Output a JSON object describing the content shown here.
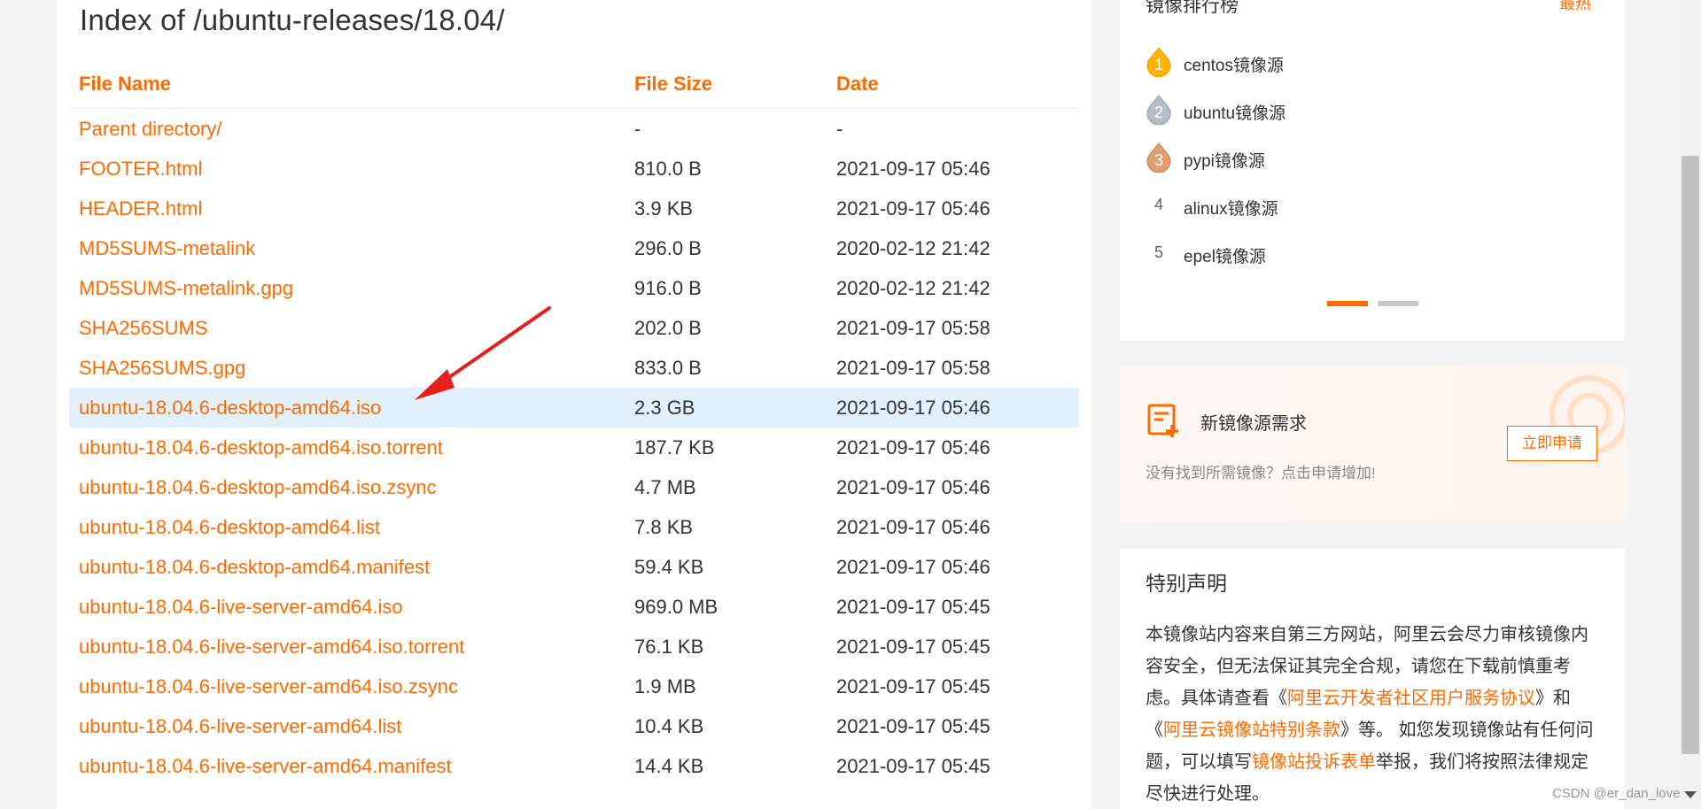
{
  "page_title": "Index of /ubuntu-releases/18.04/",
  "table": {
    "headers": [
      "File Name",
      "File Size",
      "Date"
    ],
    "rows": [
      {
        "name": "Parent directory/",
        "size": "-",
        "date": "-"
      },
      {
        "name": "FOOTER.html",
        "size": "810.0 B",
        "date": "2021-09-17 05:46"
      },
      {
        "name": "HEADER.html",
        "size": "3.9 KB",
        "date": "2021-09-17 05:46"
      },
      {
        "name": "MD5SUMS-metalink",
        "size": "296.0 B",
        "date": "2020-02-12 21:42"
      },
      {
        "name": "MD5SUMS-metalink.gpg",
        "size": "916.0 B",
        "date": "2020-02-12 21:42"
      },
      {
        "name": "SHA256SUMS",
        "size": "202.0 B",
        "date": "2021-09-17 05:58"
      },
      {
        "name": "SHA256SUMS.gpg",
        "size": "833.0 B",
        "date": "2021-09-17 05:58"
      },
      {
        "name": "ubuntu-18.04.6-desktop-amd64.iso",
        "size": "2.3 GB",
        "date": "2021-09-17 05:46"
      },
      {
        "name": "ubuntu-18.04.6-desktop-amd64.iso.torrent",
        "size": "187.7 KB",
        "date": "2021-09-17 05:46"
      },
      {
        "name": "ubuntu-18.04.6-desktop-amd64.iso.zsync",
        "size": "4.7 MB",
        "date": "2021-09-17 05:46"
      },
      {
        "name": "ubuntu-18.04.6-desktop-amd64.list",
        "size": "7.8 KB",
        "date": "2021-09-17 05:46"
      },
      {
        "name": "ubuntu-18.04.6-desktop-amd64.manifest",
        "size": "59.4 KB",
        "date": "2021-09-17 05:46"
      },
      {
        "name": "ubuntu-18.04.6-live-server-amd64.iso",
        "size": "969.0 MB",
        "date": "2021-09-17 05:45"
      },
      {
        "name": "ubuntu-18.04.6-live-server-amd64.iso.torrent",
        "size": "76.1 KB",
        "date": "2021-09-17 05:45"
      },
      {
        "name": "ubuntu-18.04.6-live-server-amd64.iso.zsync",
        "size": "1.9 MB",
        "date": "2021-09-17 05:45"
      },
      {
        "name": "ubuntu-18.04.6-live-server-amd64.list",
        "size": "10.4 KB",
        "date": "2021-09-17 05:45"
      },
      {
        "name": "ubuntu-18.04.6-live-server-amd64.manifest",
        "size": "14.4 KB",
        "date": "2021-09-17 05:45"
      }
    ],
    "highlighted_row": "ubuntu-18.04.6-desktop-amd64.iso"
  },
  "sidebar": {
    "ranking": {
      "title": "镜像排行榜",
      "more": "最热",
      "items": [
        {
          "rank": "1",
          "name": "centos镜像源",
          "badge": "gold-drop-icon"
        },
        {
          "rank": "2",
          "name": "ubuntu镜像源",
          "badge": "silver-drop-icon"
        },
        {
          "rank": "3",
          "name": "pypi镜像源",
          "badge": "bronze-drop-icon"
        },
        {
          "rank": "4",
          "name": "alinux镜像源",
          "badge": ""
        },
        {
          "rank": "5",
          "name": "epel镜像源",
          "badge": ""
        }
      ]
    },
    "request": {
      "title": "新镜像源需求",
      "button": "立即申请",
      "desc": "没有找到所需镜像？点击申请增加!"
    },
    "notice": {
      "title": "特别声明",
      "text_1": "本镜像站内容来自第三方网站，阿里云会尽力审核镜像内容安全，但无法保证其完全合规，请您在下载前慎重考虑。具体请查看《",
      "link_1": "阿里云开发者社区用户服务协议",
      "text_2": "》和《",
      "link_2": "阿里云镜像站特别条款",
      "text_3": "》等。 如您发现镜像站有任何问题，可以填写",
      "link_3": "镜像站投诉表单",
      "text_4": "举报，我们将按照法律规定尽快进行处理。"
    }
  },
  "watermark": "CSDN @er_dan_love",
  "colors": {
    "accent": "#ff6a00",
    "highlight_row": "#e1f0fa",
    "arrow": "#e5201b"
  }
}
